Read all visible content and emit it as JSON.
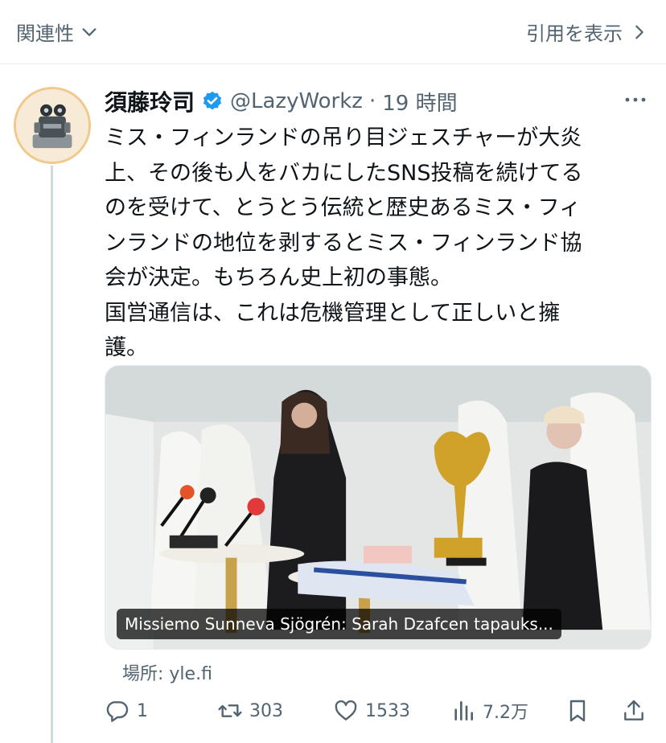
{
  "topbar": {
    "related_label": "関連性",
    "quote_label": "引用を表示"
  },
  "tweet": {
    "author_name": "須藤玲司",
    "handle": "@LazyWorkz",
    "separator": "·",
    "time": "19 時間",
    "body_lines": [
      "ミス・フィンランドの吊り目ジェスチャーが大炎",
      "上、その後も人をバカにしたSNS投稿を続けてる",
      "のを受けて、とうとう伝統と歴史あるミス・フィ",
      "ンランドの地位を剥するとミス・フィンランド協",
      "会が決定。もちろん史上初の事態。",
      "国営通信は、これは危機管理として正しいと擁",
      "護。"
    ],
    "card_caption": "Missiemo Sunneva Sjögrén: Sarah Dzafcen tapauks...",
    "source": "場所: yle.fi"
  },
  "actions": {
    "reply_count": "1",
    "retweet_count": "303",
    "like_count": "1533",
    "view_count": "7.2万"
  },
  "colors": {
    "verified_blue": "#1d9bf0",
    "muted_text": "#536471",
    "thread_line": "#cfd9de"
  }
}
